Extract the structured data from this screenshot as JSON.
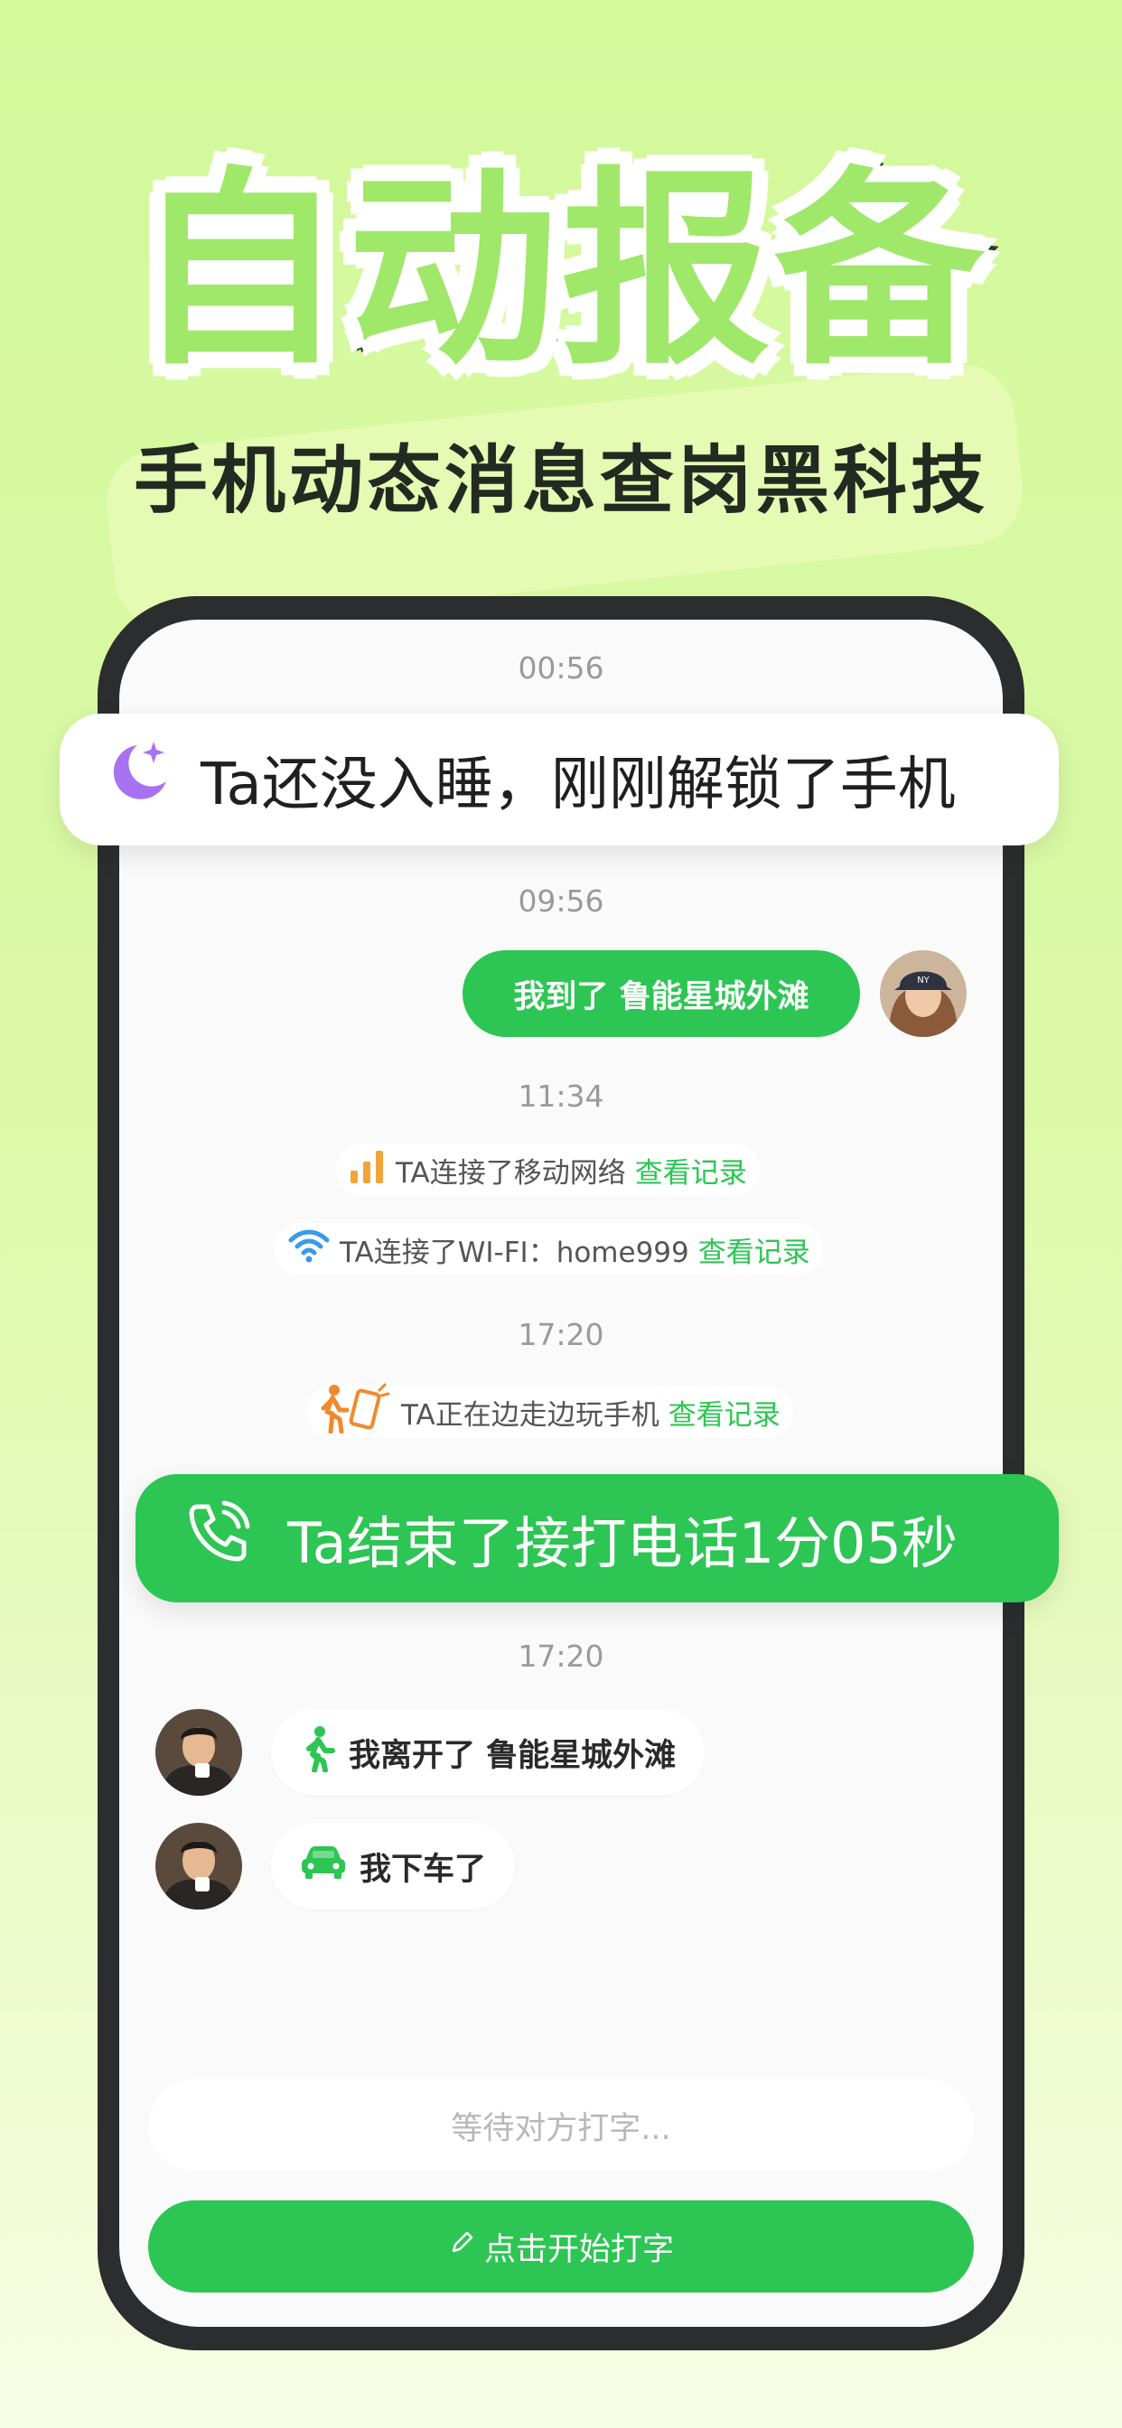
{
  "hero": {
    "title": "自动报备",
    "subtitle": "手机动态消息查岗黑科技"
  },
  "chat": {
    "time_1": "00:56",
    "time_2": "09:56",
    "my_message": "我到了 鲁能星城外滩",
    "time_3": "11:34",
    "notice_mobile": {
      "icon": "signal-bars-icon",
      "text": "TA连接了移动网络",
      "link": "查看记录"
    },
    "notice_wifi": {
      "icon": "wifi-icon",
      "text": "TA连接了WI-FI：home999",
      "link": "查看记录"
    },
    "time_4": "17:20",
    "notice_walk": {
      "icon": "walking-phone-icon",
      "text": "TA正在边走边玩手机",
      "link": "查看记录"
    },
    "time_5": "17:20",
    "incoming": [
      {
        "icon": "walking-person-icon",
        "text": "我离开了 鲁能星城外滩"
      },
      {
        "icon": "car-icon",
        "text": "我下车了"
      }
    ]
  },
  "input": {
    "waiting_text": "等待对方打字...",
    "start_typing_label": "点击开始打字"
  },
  "banners": {
    "sleep": {
      "icon": "moon-star-icon",
      "text": "Ta还没入睡，刚刚解锁了手机"
    },
    "call": {
      "icon": "phone-call-icon",
      "text": "Ta结束了接打电话1分05秒"
    }
  },
  "colors": {
    "accent_green": "#2dc553",
    "title_green": "#9fe86a",
    "moon_purple": "#a772f2",
    "signal_orange": "#f2a43a",
    "wifi_blue": "#3a9ae8",
    "phone_frame": "#2c2d2f"
  }
}
